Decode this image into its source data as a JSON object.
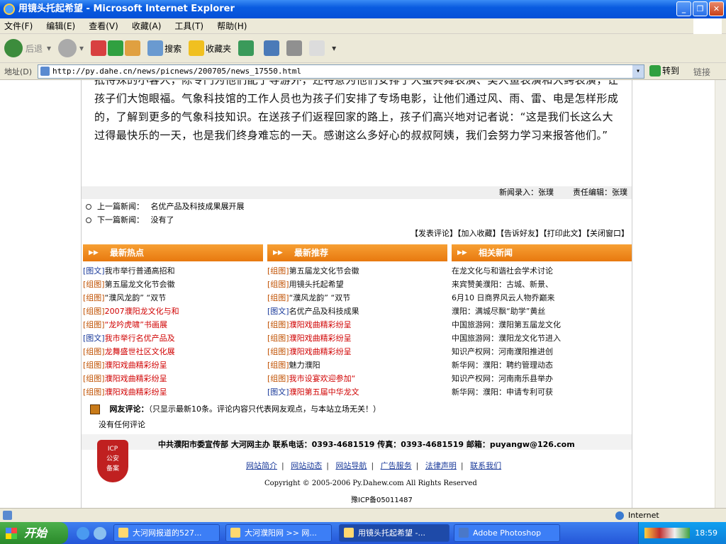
{
  "window": {
    "title": "用镜头托起希望 - Microsoft Internet Explorer"
  },
  "menu": [
    "文件(F)",
    "编辑(E)",
    "查看(V)",
    "收藏(A)",
    "工具(T)",
    "帮助(H)"
  ],
  "toolbar": {
    "back": "后退",
    "search": "搜索",
    "favorites": "收藏夹"
  },
  "address": {
    "label": "地址(D)",
    "url": "http://py.dahe.cn/news/picnews/200705/news_17550.html",
    "go": "转到",
    "links": "链接"
  },
  "article": {
    "text": "抵待殊的小客人，陈专门为他们配了导游外，还特意为他们安排了大蚕共舞表演、美人鱼表演和大鳄表演，让孩子们大饱眼福。气象科技馆的工作人员也为孩子们安排了专场电影，让他们通过风、雨、雷、电是怎样形成的，了解到更多的气象科技知识。在送孩子们返程回家的路上，孩子们高兴地对记者说：“这是我们长这么大过得最快乐的一天，也是我们终身难忘的一天。感谢这么多好心的叔叔阿姨，我们会努力学习来报答他们。”"
  },
  "editors": {
    "entry": "新闻录入：张璞",
    "chief": "责任编辑：张璞"
  },
  "prev": {
    "label": "上一篇新闻：",
    "title": "名优产品及科技成果展开展"
  },
  "next": {
    "label": "下一篇新闻：",
    "title": "没有了"
  },
  "actions": "【发表评论】【加入收藏】【告诉好友】【打印此文】【关闭窗口】",
  "columns": [
    {
      "title": "最新热点",
      "items": [
        {
          "tag": "[图文]",
          "tagBlue": true,
          "text": "我市举行普通高招和",
          "red": false
        },
        {
          "tag": "[组图]",
          "tagBlue": false,
          "text": "第五届龙文化节会徽",
          "red": false
        },
        {
          "tag": "[组图]",
          "tagBlue": false,
          "text": "“濮风龙韵” “双节",
          "red": false
        },
        {
          "tag": "[组图]",
          "tagBlue": false,
          "text": "2007濮阳龙文化与和",
          "red": true
        },
        {
          "tag": "[组图]",
          "tagBlue": false,
          "text": "“龙吟虎啸”书画展",
          "red": true
        },
        {
          "tag": "[图文]",
          "tagBlue": true,
          "text": "我市举行名优产品及",
          "red": true
        },
        {
          "tag": "[组图]",
          "tagBlue": false,
          "text": "龙舞盛世社区文化展",
          "red": true
        },
        {
          "tag": "[组图]",
          "tagBlue": false,
          "text": "濮阳戏曲精彩纷呈",
          "red": true
        },
        {
          "tag": "[组图]",
          "tagBlue": false,
          "text": "濮阳戏曲精彩纷呈",
          "red": true
        },
        {
          "tag": "[组图]",
          "tagBlue": false,
          "text": "濮阳戏曲精彩纷呈",
          "red": true
        }
      ]
    },
    {
      "title": "最新推荐",
      "items": [
        {
          "tag": "[组图]",
          "tagBlue": false,
          "text": "第五届龙文化节会徽",
          "red": false
        },
        {
          "tag": "[组图]",
          "tagBlue": false,
          "text": "用镜头托起希望",
          "red": false
        },
        {
          "tag": "[组图]",
          "tagBlue": false,
          "text": "“濮风龙韵” “双节",
          "red": false
        },
        {
          "tag": "[图文]",
          "tagBlue": true,
          "text": "名优产品及科技成果",
          "red": false
        },
        {
          "tag": "[组图]",
          "tagBlue": false,
          "text": "濮阳戏曲精彩纷呈",
          "red": true
        },
        {
          "tag": "[组图]",
          "tagBlue": false,
          "text": "濮阳戏曲精彩纷呈",
          "red": true
        },
        {
          "tag": "[组图]",
          "tagBlue": false,
          "text": "濮阳戏曲精彩纷呈",
          "red": true
        },
        {
          "tag": "[组图]",
          "tagBlue": false,
          "text": "魅力濮阳",
          "red": false
        },
        {
          "tag": "[组图]",
          "tagBlue": false,
          "text": "我市设宴欢迎参加“",
          "red": true
        },
        {
          "tag": "[图文]",
          "tagBlue": true,
          "text": "濮阳第五届中华龙文",
          "red": true
        }
      ]
    },
    {
      "title": "相关新闻",
      "items": [
        {
          "tag": "",
          "tagBlue": false,
          "text": "在龙文化与和谐社会学术讨论",
          "red": false
        },
        {
          "tag": "",
          "tagBlue": false,
          "text": "来宾赞美濮阳：古城、新景、",
          "red": false
        },
        {
          "tag": "",
          "tagBlue": false,
          "text": "6月10 日商界风云人物乔巅来",
          "red": false
        },
        {
          "tag": "",
          "tagBlue": false,
          "text": "濮阳：满城尽飘“助学”黄丝",
          "red": false
        },
        {
          "tag": "",
          "tagBlue": false,
          "text": "中国旅游网：濮阳第五届龙文化",
          "red": false
        },
        {
          "tag": "",
          "tagBlue": false,
          "text": "中国旅游网：濮阳龙文化节进入",
          "red": false
        },
        {
          "tag": "",
          "tagBlue": false,
          "text": "知识产权网：河南濮阳推进创",
          "red": false
        },
        {
          "tag": "",
          "tagBlue": false,
          "text": "新华网：濮阳：聘约管理动态",
          "red": false
        },
        {
          "tag": "",
          "tagBlue": false,
          "text": "知识产权网：河南南乐县举办",
          "red": false
        },
        {
          "tag": "",
          "tagBlue": false,
          "text": "新华网：濮阳：申请专利可获",
          "red": false
        }
      ]
    }
  ],
  "comments": {
    "heading": "网友评论：",
    "note": "（只显示最新10条。评论内容只代表网友观点，与本站立场无关！）",
    "empty": "没有任何评论"
  },
  "footer": {
    "contact": "中共濮阳市委宣传部  大河网主办  联系电话：0393-4681519  传真：0393-4681519  邮箱：puyangw@126.com",
    "links": [
      "网站简介",
      "网站动态",
      "网站导航",
      "广告服务",
      "法律声明",
      "联系我们"
    ],
    "copyright": "Copyright © 2005-2006 Py.Dahew.com All Rights Reserved",
    "icp": "豫ICP备05011487",
    "badge": [
      "ICP",
      "公安",
      "备案"
    ]
  },
  "status": {
    "zone": "Internet"
  },
  "taskbar": {
    "start": "开始",
    "tasks": [
      "大河网报道的527...",
      "大河濮阳网 >> 网...",
      "用镜头托起希望 -...",
      "Adobe Photoshop"
    ],
    "clock": "18:59"
  }
}
